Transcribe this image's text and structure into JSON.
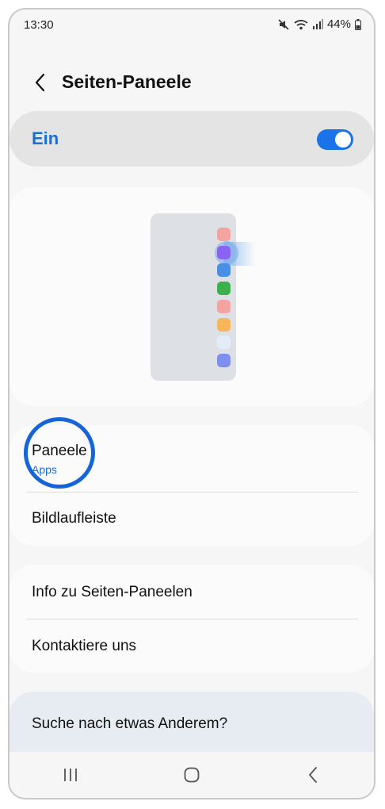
{
  "status_bar": {
    "time": "13:30",
    "battery": "44%",
    "icons": [
      "mute-icon",
      "wifi-icon",
      "signal-icon",
      "battery-icon"
    ]
  },
  "header": {
    "title": "Seiten-Paneele",
    "back_icon": "chevron-left-icon"
  },
  "master_switch": {
    "label": "Ein",
    "on": true
  },
  "illustration": {
    "dot_colors": [
      "#f4a4a0",
      "#8b63f2",
      "#4a8fe6",
      "#3cb04a",
      "#f4a4a0",
      "#f8b65a",
      "#e3edf8",
      "#7e8ff0"
    ]
  },
  "settings": {
    "panels": {
      "title": "Paneele",
      "subtitle": "Apps"
    },
    "scrollbar": {
      "title": "Bildlaufleiste"
    },
    "about": {
      "title": "Info zu Seiten-Paneelen"
    },
    "contact": {
      "title": "Kontaktiere uns"
    }
  },
  "suggestion": {
    "title": "Suche nach etwas Anderem?"
  },
  "navbar": {
    "icons": [
      "recent-apps-icon",
      "home-icon",
      "back-icon"
    ]
  },
  "colors": {
    "accent": "#1a73e8",
    "highlight": "#1565d8"
  }
}
